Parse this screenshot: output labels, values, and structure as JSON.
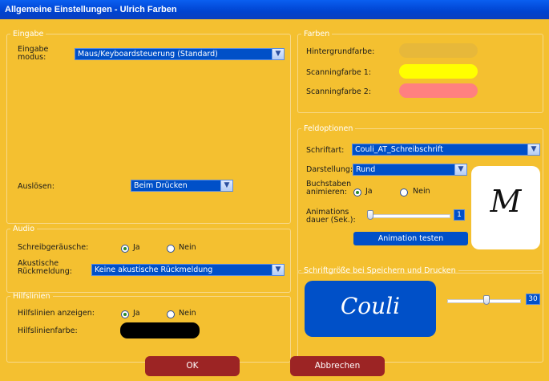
{
  "window": {
    "title": "Allgemeine Einstellungen - Ulrich Farben"
  },
  "eingabe": {
    "legend": "Eingabe",
    "modus_label": "Eingabe\nmodus:",
    "modus_value": "Maus/Keyboardsteuerung (Standard)",
    "ausloesen_label": "Auslösen:",
    "ausloesen_value": "Beim Drücken"
  },
  "audio": {
    "legend": "Audio",
    "schreib_label": "Schreibgeräusche:",
    "ja": "Ja",
    "nein": "Nein",
    "rueck_label": "Akustische\nRückmeldung:",
    "rueck_value": "Keine akustische Rückmeldung"
  },
  "hilfslinien": {
    "legend": "Hilfslinien",
    "anzeigen_label": "Hilfslinien anzeigen:",
    "ja": "Ja",
    "nein": "Nein",
    "farbe_label": "Hilfslinienfarbe:",
    "farbe": "#000000"
  },
  "farben": {
    "legend": "Farben",
    "hintergrund_label": "Hintergrundfarbe:",
    "hintergrund": "#e7b83a",
    "scan1_label": "Scanningfarbe 1:",
    "scan1": "#ffff00",
    "scan2_label": "Scanningfarbe 2:",
    "scan2": "#ff8080"
  },
  "feldoptionen": {
    "legend": "Feldoptionen",
    "schriftart_label": "Schriftart:",
    "schriftart_value": "Couli_AT_Schreibschrift",
    "darstellung_label": "Darstellung:",
    "darstellung_value": "Rund",
    "animieren_label": "Buchstaben\nanimieren:",
    "ja": "Ja",
    "nein": "Nein",
    "dauer_label": "Animations\ndauer (Sek.):",
    "dauer_value": "1",
    "dauer_fraction": 0.0,
    "test_button": "Animation testen",
    "preview_letter": "M"
  },
  "schriftgroesse": {
    "legend": "Schriftgröße bei Speichern und Drucken",
    "preview_text": "Couli",
    "size_value": "30",
    "size_fraction": 0.55
  },
  "buttons": {
    "ok": "OK",
    "abbrechen": "Abbrechen"
  },
  "colors": {
    "background": "#f4c030",
    "accent_blue": "#0050c8",
    "button_red": "#9c2424"
  }
}
